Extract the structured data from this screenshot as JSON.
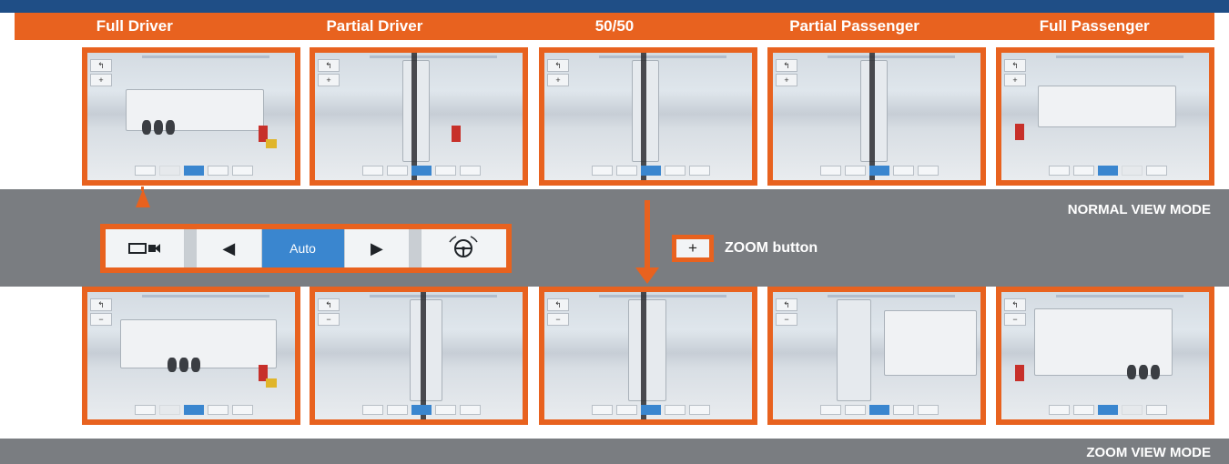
{
  "header": {
    "columns": [
      "Full Driver",
      "Partial Driver",
      "50/50",
      "Partial Passenger",
      "Full Passenger"
    ]
  },
  "controls": {
    "auto_label": "Auto",
    "camera_icon": "camera-icon",
    "left_icon": "arrow-left-icon",
    "right_icon": "arrow-right-icon",
    "wheel_icon": "steering-wheel-icon"
  },
  "zoom": {
    "button_symbol": "+",
    "label": "ZOOM button"
  },
  "modes": {
    "normal": "NORMAL VIEW MODE",
    "zoom": "ZOOM VIEW MODE"
  },
  "thumb_buttons": {
    "back": "↰",
    "plus": "+",
    "minus": "−"
  },
  "colors": {
    "accent": "#e8621f",
    "top_bar": "#1f4e86",
    "gray_band": "#7a7d81",
    "auto_blue": "#3a86cf"
  }
}
